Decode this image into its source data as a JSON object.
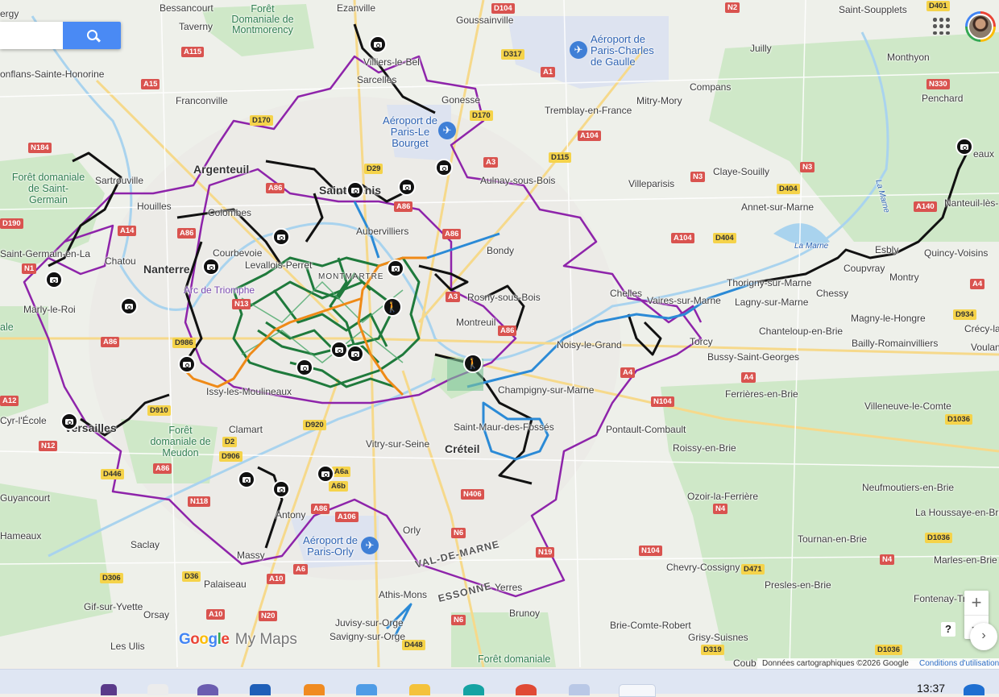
{
  "search": {
    "placeholder": ""
  },
  "toolbar": {
    "apps_icon": "apps-grid-icon",
    "account_icon": "user-avatar-icon"
  },
  "places": {
    "bessancourt": "Bessancourt",
    "ezanville": "Ezanville",
    "goussainville": "Goussainville",
    "saint_soupplets": "Saint-Soupplets",
    "ergy": "ergy",
    "taverny": "Taverny",
    "foret_montmorency": "Forêt Domaniale de Montmorency",
    "aeroport_cdg": "Aéroport de Paris-Charles de Gaulle",
    "juilly": "Juilly",
    "monthyon": "Monthyon",
    "villiers_le_bel": "Villiers-le-Bel",
    "sarcelles": "Sarcelles",
    "conflans": "onflans-Sainte-Honorine",
    "franconville": "Franconville",
    "compans": "Compans",
    "penchard": "Penchard",
    "gonesse": "Gonesse",
    "mitry_mory": "Mitry-Mory",
    "aeroport_bourget": "Aéroport de Paris-Le Bourget",
    "tremblay": "Tremblay-en-France",
    "argenteuil": "Argenteuil",
    "sartrouville": "Sartrouville",
    "foret_saint_germain": "Forêt domaniale de Saint-Germain",
    "claye_souilly": "Claye-Souilly",
    "meaux": "eaux",
    "saint_denis": "Saint-Denis",
    "aulnay": "Aulnay-sous-Bois",
    "villeparisis": "Villeparisis",
    "houilles": "Houilles",
    "colombes": "Colombes",
    "annet": "Annet-sur-Marne",
    "nanteuil": "Nanteuil-lès-",
    "aubervilliers": "Aubervilliers",
    "la_marne": "La Marne",
    "la_marne_2": "La Marne",
    "saint_germain": "Saint-Germain-en-La",
    "chatou": "Chatou",
    "nanterre": "Nanterre",
    "bondy": "Bondy",
    "courbevoie": "Courbevoie",
    "levallois": "Levallois-Perret",
    "esbly": "Esbly",
    "coupvray": "Coupvray",
    "quincy": "Quincy-Voisins",
    "montmartre": "MONTMARTRE",
    "arc_triomphe": "Arc de Triomphe",
    "montry": "Montry",
    "thorigny": "Thorigny-sur-Marne",
    "chessy": "Chessy",
    "marly": "Marly-le-Roi",
    "rosny": "Rosny-sous-Bois",
    "chelles": "Chelles",
    "vaires": "Vaires-sur-Marne",
    "lagny": "Lagny-sur-Marne",
    "magny": "Magny-le-Hongre",
    "montreuil": "Montreuil",
    "chanteloup": "Chanteloup-en-Brie",
    "crecy": "Crécy-la",
    "bailly": "Bailly-Romainvilliers",
    "voulan": "Voulan",
    "ale": "ale",
    "noisy": "Noisy-le-Grand",
    "torcy": "Torcy",
    "bussy": "Bussy-Saint-Georges",
    "issy": "Issy-les-Moulineaux",
    "champigny": "Champigny-sur-Marne",
    "ferrieres": "Ferrières-en-Brie",
    "villeneuve_comte": "Villeneuve-le-Comte",
    "cyr": "Cyr-l'École",
    "versailles": "Versailles",
    "clamart": "Clamart",
    "saint_maur": "Saint-Maur-des-Fossés",
    "pontault": "Pontault-Combault",
    "foret_meudon": "Forêt domaniale de Meudon",
    "vitry": "Vitry-sur-Seine",
    "creteil": "Créteil",
    "roissy_brie": "Roissy-en-Brie",
    "guyancourt": "Guyancourt",
    "neufmoutiers": "Neufmoutiers-en-Brie",
    "antony": "Antony",
    "ozoir": "Ozoir-la-Ferrière",
    "la_houssaye": "La Houssaye-en-Brie",
    "hameaux": "Hameaux",
    "saclay": "Saclay",
    "aeroport_orly": "Aéroport de Paris-Orly",
    "orly": "Orly",
    "tournan": "Tournan-en-Brie",
    "massy": "Massy",
    "val_de_marne": "VAL-DE-MARNE",
    "marles": "Marles-en-Brie",
    "palaiseau": "Palaiseau",
    "chevry": "Chevry-Cossigny",
    "essonne": "ESSONNE",
    "yerres": "Yerres",
    "presles": "Presles-en-Brie",
    "athis_mons": "Athis-Mons",
    "fontenay_tresigny": "Fontenay-Tr",
    "gif": "Gif-sur-Yvette",
    "orsay": "Orsay",
    "brunoy": "Brunoy",
    "juvisy": "Juvisy-sur-Orge",
    "brie_comte": "Brie-Comte-Robert",
    "savigny": "Savigny-sur-Orge",
    "les_ulis": "Les Ulis",
    "grisy": "Grisy-Suisnes",
    "foret_bottom": "Forêt domaniale",
    "coub": "Coub"
  },
  "roads": {
    "d104_top": "D104",
    "n2": "N2",
    "d401": "D401",
    "a115": "A115",
    "d317": "D317",
    "a1": "A1",
    "a15": "A15",
    "n330": "N330",
    "d170_top": "D170",
    "d170": "D170",
    "a104_top": "A104",
    "n184": "N184",
    "d115": "D115",
    "a3_top": "A3",
    "d29": "D29",
    "n3": "N3",
    "n3_right": "N3",
    "d404_top": "D404",
    "a86_top": "A86",
    "a86_denis": "A86",
    "d190": "D190",
    "a140": "A140",
    "a14": "A14",
    "a86_mid": "A86",
    "a86_bondy": "A86",
    "a104_mid": "A104",
    "d404_mid": "D404",
    "n1": "N1",
    "n13": "N13",
    "a4_right": "A4",
    "a3_mid": "A3",
    "d934": "D934",
    "a86_left": "A86",
    "a86_east": "A86",
    "d986": "D986",
    "a4": "A4",
    "a4_east": "A4",
    "a12": "A12",
    "n104": "N104",
    "d910": "D910",
    "d1036": "D1036",
    "d920": "D920",
    "n12": "N12",
    "d2": "D2",
    "d906": "D906",
    "d446": "D446",
    "a86_sw": "A86",
    "a6a": "A6a",
    "a6b": "A6b",
    "n118": "N118",
    "a86_s": "A86",
    "a106": "A106",
    "n406": "N406",
    "n4": "N4",
    "d1036_b": "D1036",
    "n6": "N6",
    "n19": "N19",
    "n104_b": "N104",
    "n4_b": "N4",
    "d306": "D306",
    "d36": "D36",
    "d471": "D471",
    "a10": "A10",
    "a6": "A6",
    "a10_b": "A10",
    "n20": "N20",
    "n6_b": "N6",
    "d448": "D448",
    "d319": "D319",
    "d1036_c": "D1036"
  },
  "markers": {
    "cameras": [
      "camera-icon",
      "camera-icon",
      "camera-icon",
      "camera-icon",
      "camera-icon",
      "camera-icon",
      "camera-icon",
      "camera-icon",
      "camera-icon",
      "camera-icon",
      "camera-icon",
      "camera-icon",
      "camera-icon",
      "camera-icon",
      "camera-icon",
      "camera-icon",
      "camera-icon",
      "camera-icon",
      "camera-icon"
    ],
    "hikers": [
      "hiker-icon",
      "hiker-icon"
    ],
    "airports": [
      "plane-icon",
      "plane-icon",
      "plane-icon"
    ]
  },
  "brand": {
    "logo": "Google",
    "product": "My Maps"
  },
  "footer": {
    "attribution": "Données cartographiques ©2026 Google",
    "terms": "Conditions d'utilisation"
  },
  "controls": {
    "zoom_in": "+",
    "zoom_out": "−",
    "help": "?",
    "expand": "›"
  },
  "taskbar": {
    "time": "13:37"
  },
  "colors": {
    "map_bg": "#f1efe9",
    "green_area": "#cfe8c8",
    "water": "#a9d3ee",
    "route_purple": "#8e24aa",
    "route_black": "#111111",
    "route_green": "#1f7a3c",
    "route_orange": "#ef8a17",
    "route_blue": "#2b8ad6",
    "search_button": "#4a8af4"
  }
}
